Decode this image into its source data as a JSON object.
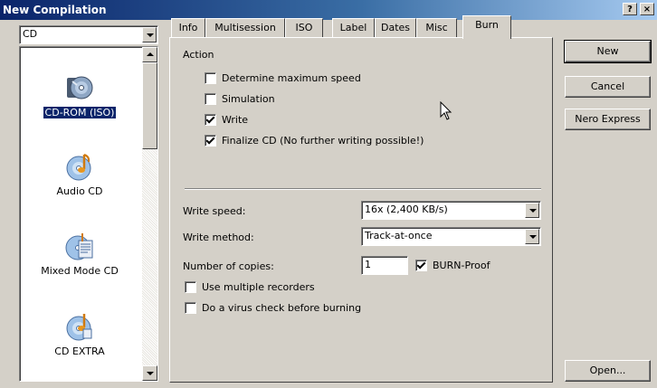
{
  "window": {
    "title": "New Compilation",
    "help_label": "?",
    "close_label": "×"
  },
  "media_type": {
    "selected": "CD"
  },
  "compilations": [
    {
      "label": "CD-ROM (ISO)",
      "icon": "cd-rom-iso-icon",
      "selected": true
    },
    {
      "label": "Audio CD",
      "icon": "audio-cd-icon",
      "selected": false
    },
    {
      "label": "Mixed Mode CD",
      "icon": "mixed-mode-cd-icon",
      "selected": false
    },
    {
      "label": "CD EXTRA",
      "icon": "cd-extra-icon",
      "selected": false
    }
  ],
  "tabs": [
    {
      "label": "Info"
    },
    {
      "label": "Multisession"
    },
    {
      "label": "ISO"
    },
    {
      "label": "Label"
    },
    {
      "label": "Dates"
    },
    {
      "label": "Misc"
    },
    {
      "label": "Burn",
      "active": true
    }
  ],
  "burn": {
    "action_heading": "Action",
    "actions": [
      {
        "label": "Determine maximum speed",
        "checked": false
      },
      {
        "label": "Simulation",
        "checked": false
      },
      {
        "label": "Write",
        "checked": true
      },
      {
        "label": "Finalize CD (No further writing possible!)",
        "checked": true
      }
    ],
    "write_speed_label": "Write speed:",
    "write_speed_value": "16x (2,400 KB/s)",
    "write_method_label": "Write method:",
    "write_method_value": "Track-at-once",
    "copies_label": "Number of copies:",
    "copies_value": "1",
    "burn_proof_label": "BURN-Proof",
    "burn_proof_checked": true,
    "multiple_recorders_label": "Use multiple recorders",
    "multiple_recorders_checked": false,
    "virus_check_label": "Do a virus check before burning",
    "virus_check_checked": false
  },
  "buttons": {
    "new": "New",
    "cancel": "Cancel",
    "nero_express": "Nero Express",
    "open": "Open..."
  }
}
